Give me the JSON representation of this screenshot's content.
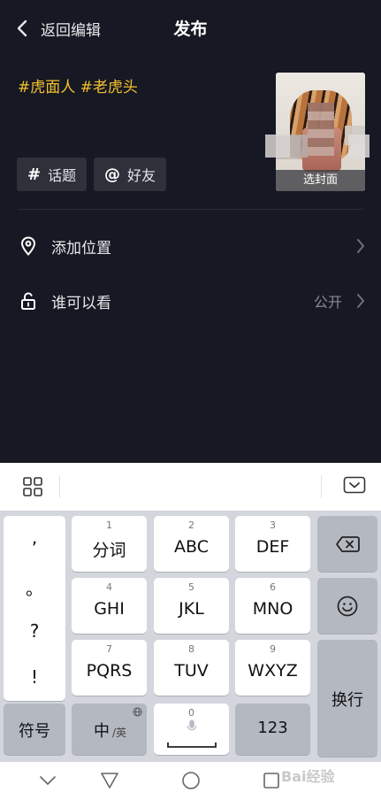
{
  "header": {
    "back_label": "返回编辑",
    "title": "发布"
  },
  "caption": "#虎面人 #老虎头",
  "cover": {
    "label": "选封面"
  },
  "chips": [
    {
      "symbol": "#",
      "label": "话题"
    },
    {
      "symbol": "@",
      "label": "好友"
    }
  ],
  "rows": {
    "location": {
      "label": "添加位置"
    },
    "visibility": {
      "label": "谁可以看",
      "value": "公开"
    }
  },
  "keyboard": {
    "punct": [
      ",",
      "。",
      "?",
      "!"
    ],
    "keys": [
      {
        "num": "1",
        "label": "分词"
      },
      {
        "num": "2",
        "label": "ABC"
      },
      {
        "num": "3",
        "label": "DEF"
      },
      {
        "num": "4",
        "label": "GHI"
      },
      {
        "num": "5",
        "label": "JKL"
      },
      {
        "num": "6",
        "label": "MNO"
      },
      {
        "num": "7",
        "label": "PQRS"
      },
      {
        "num": "8",
        "label": "TUV"
      },
      {
        "num": "9",
        "label": "WXYZ"
      }
    ],
    "symbols_label": "符号",
    "lang_main": "中",
    "lang_sub": "/英",
    "space_num": "0",
    "num_label": "123",
    "enter_label": "换行"
  },
  "watermark": "Bai经验"
}
